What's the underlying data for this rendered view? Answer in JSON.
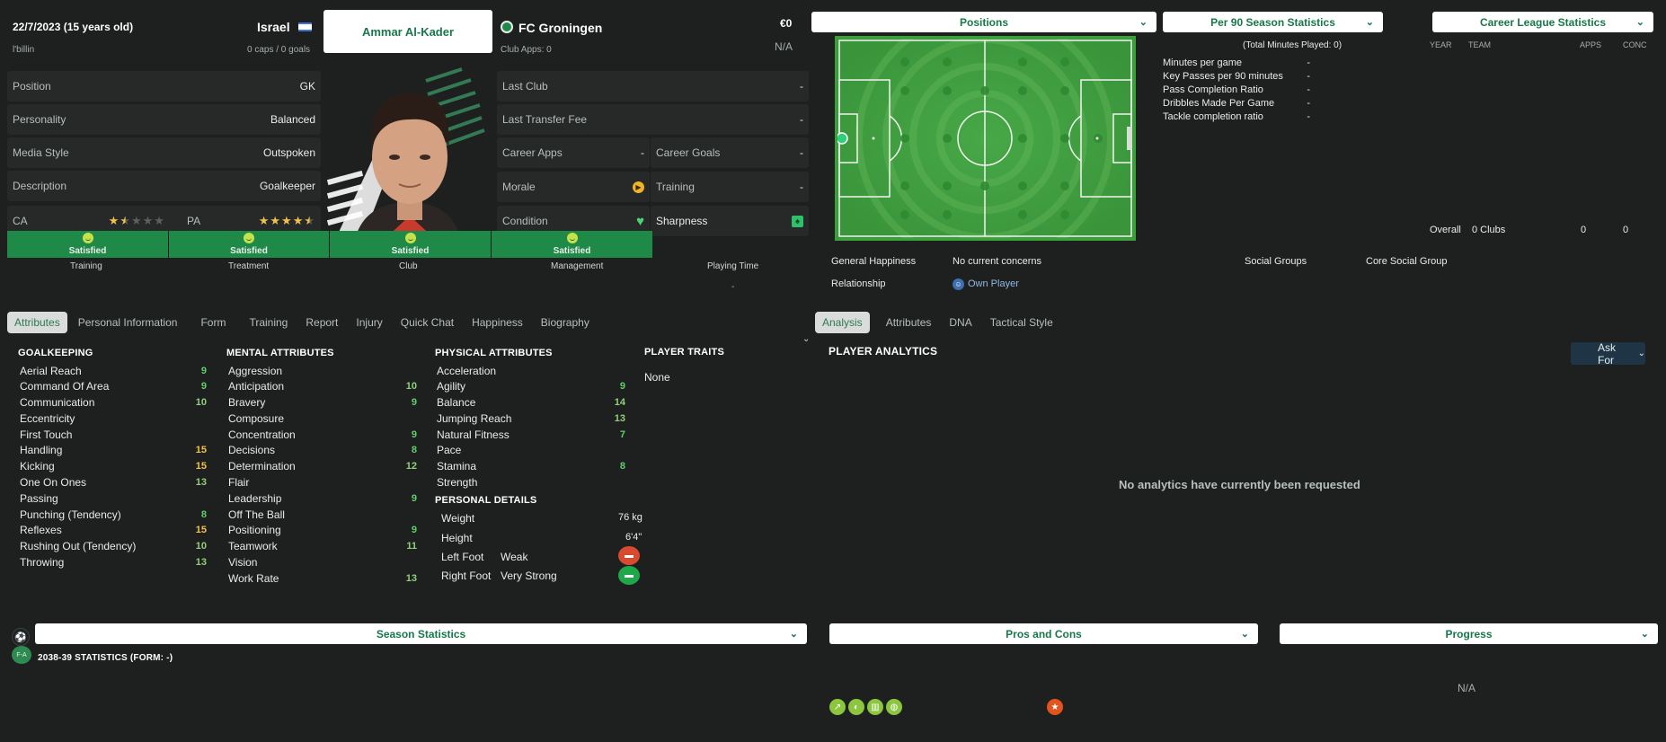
{
  "header": {
    "dob": "22/7/2023 (15 years old)",
    "nation": "Israel",
    "secondary": "l'billin",
    "caps_goals": "0 caps / 0 goals",
    "player_name": "Ammar Al-Kader",
    "club": "FC Groningen",
    "club_apps": "Club Apps: 0",
    "value": "€0",
    "contract": "N/A"
  },
  "left_info": [
    {
      "label": "Position",
      "value": "GK"
    },
    {
      "label": "Personality",
      "value": "Balanced"
    },
    {
      "label": "Media Style",
      "value": "Outspoken"
    },
    {
      "label": "Description",
      "value": "Goalkeeper"
    }
  ],
  "ability": {
    "ca_label": "CA",
    "pa_label": "PA",
    "ca_stars": 1.5,
    "pa_stars": 4.5
  },
  "club_info": {
    "last_club_label": "Last Club",
    "last_club": "-",
    "last_fee_label": "Last Transfer Fee",
    "last_fee": "-",
    "career_apps_label": "Career Apps",
    "career_apps": "-",
    "career_goals_label": "Career Goals",
    "career_goals": "-",
    "morale_label": "Morale",
    "training_label": "Training",
    "training": "-",
    "condition_label": "Condition",
    "sharpness_label": "Sharpness"
  },
  "happiness_bar": [
    {
      "title": "Training",
      "status": "Satisfied"
    },
    {
      "title": "Treatment",
      "status": "Satisfied"
    },
    {
      "title": "Club",
      "status": "Satisfied"
    },
    {
      "title": "Management",
      "status": "Satisfied"
    }
  ],
  "playing_time": {
    "title": "Playing Time",
    "value": "-"
  },
  "left_tabs": [
    "Attributes",
    "Personal Information",
    "Form",
    "Training",
    "Report",
    "Injury",
    "Quick Chat",
    "Happiness",
    "Biography"
  ],
  "goalkeeping": {
    "title": "GOALKEEPING",
    "items": [
      {
        "name": "Aerial Reach",
        "value": "9",
        "tone": "green"
      },
      {
        "name": "Command Of Area",
        "value": "9",
        "tone": "green"
      },
      {
        "name": "Communication",
        "value": "10",
        "tone": "lgreen"
      },
      {
        "name": "Eccentricity",
        "value": "",
        "tone": "green"
      },
      {
        "name": "First Touch",
        "value": "",
        "tone": "green"
      },
      {
        "name": "Handling",
        "value": "15",
        "tone": "yellow"
      },
      {
        "name": "Kicking",
        "value": "15",
        "tone": "yellow"
      },
      {
        "name": "One On Ones",
        "value": "13",
        "tone": "lgreen"
      },
      {
        "name": "Passing",
        "value": "",
        "tone": "green"
      },
      {
        "name": "Punching (Tendency)",
        "value": "8",
        "tone": "green"
      },
      {
        "name": "Reflexes",
        "value": "15",
        "tone": "yellow"
      },
      {
        "name": "Rushing Out (Tendency)",
        "value": "10",
        "tone": "lgreen"
      },
      {
        "name": "Throwing",
        "value": "13",
        "tone": "lgreen"
      }
    ]
  },
  "mental": {
    "title": "MENTAL ATTRIBUTES",
    "items": [
      {
        "name": "Aggression",
        "value": "",
        "tone": "green"
      },
      {
        "name": "Anticipation",
        "value": "10",
        "tone": "lgreen"
      },
      {
        "name": "Bravery",
        "value": "9",
        "tone": "green"
      },
      {
        "name": "Composure",
        "value": "",
        "tone": "green"
      },
      {
        "name": "Concentration",
        "value": "9",
        "tone": "green"
      },
      {
        "name": "Decisions",
        "value": "8",
        "tone": "green"
      },
      {
        "name": "Determination",
        "value": "12",
        "tone": "lgreen"
      },
      {
        "name": "Flair",
        "value": "",
        "tone": "green"
      },
      {
        "name": "Leadership",
        "value": "9",
        "tone": "green"
      },
      {
        "name": "Off The Ball",
        "value": "",
        "tone": "green"
      },
      {
        "name": "Positioning",
        "value": "9",
        "tone": "green"
      },
      {
        "name": "Teamwork",
        "value": "11",
        "tone": "lgreen"
      },
      {
        "name": "Vision",
        "value": "",
        "tone": "green"
      },
      {
        "name": "Work Rate",
        "value": "13",
        "tone": "lgreen"
      }
    ]
  },
  "physical": {
    "title": "PHYSICAL ATTRIBUTES",
    "items": [
      {
        "name": "Acceleration",
        "value": "",
        "tone": "green"
      },
      {
        "name": "Agility",
        "value": "9",
        "tone": "green"
      },
      {
        "name": "Balance",
        "value": "14",
        "tone": "lgreen"
      },
      {
        "name": "Jumping Reach",
        "value": "13",
        "tone": "lgreen"
      },
      {
        "name": "Natural Fitness",
        "value": "7",
        "tone": "green"
      },
      {
        "name": "Pace",
        "value": "",
        "tone": "green"
      },
      {
        "name": "Stamina",
        "value": "8",
        "tone": "green"
      },
      {
        "name": "Strength",
        "value": "",
        "tone": "green"
      }
    ]
  },
  "personal_details": {
    "title": "PERSONAL DETAILS",
    "weight_label": "Weight",
    "weight": "76 kg",
    "height_label": "Height",
    "height": "6'4\"",
    "left_foot_label": "Left Foot",
    "left_foot": "Weak",
    "right_foot_label": "Right Foot",
    "right_foot": "Very Strong"
  },
  "traits": {
    "title": "PLAYER TRAITS",
    "value": "None"
  },
  "right_dropdowns": {
    "positions": "Positions",
    "per90": "Per 90 Season Statistics",
    "career": "Career League Statistics"
  },
  "per90": {
    "total": "(Total Minutes Played: 0)",
    "rows": [
      {
        "label": "Minutes per game",
        "value": "-"
      },
      {
        "label": "Key Passes per 90 minutes",
        "value": "-"
      },
      {
        "label": "Pass Completion Ratio",
        "value": "-"
      },
      {
        "label": "Dribbles Made Per Game",
        "value": "-"
      },
      {
        "label": "Tackle completion ratio",
        "value": "-"
      }
    ]
  },
  "career": {
    "headers": [
      "YEAR",
      "TEAM",
      "APPS",
      "CONC"
    ],
    "overall": "Overall",
    "clubs": "0 Clubs",
    "apps": "0",
    "conc": "0"
  },
  "happiness_info": {
    "general_label": "General Happiness",
    "general": "No current concerns",
    "relationship_label": "Relationship",
    "relationship": "Own Player",
    "social_label": "Social Groups",
    "social": "Core Social Group"
  },
  "right_tabs": [
    "Analysis",
    "Attributes",
    "DNA",
    "Tactical Style"
  ],
  "analytics": {
    "title": "PLAYER ANALYTICS",
    "ask_for": "Ask For",
    "empty": "No analytics have currently been requested"
  },
  "bottom": {
    "season_stats": "Season Statistics",
    "season_line": "2038-39 STATISTICS (FORM: -)",
    "pros_cons": "Pros and Cons",
    "progress": "Progress",
    "progress_value": "N/A",
    "fa_badge": "F-A"
  },
  "colors": {
    "accent": "#17794a",
    "happy_green": "#1f8a48",
    "pitch": "#3c9d3a"
  }
}
